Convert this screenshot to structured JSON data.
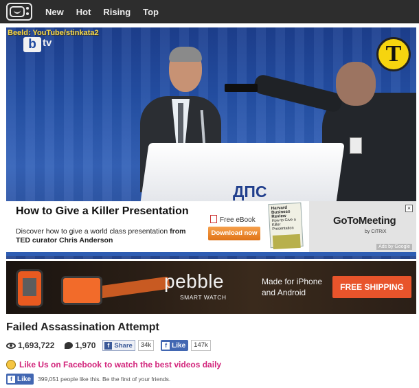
{
  "nav": {
    "items": [
      "New",
      "Hot",
      "Rising",
      "Top"
    ]
  },
  "video": {
    "credit": "Beeld: YouTube/stinkata2",
    "channel_b": "b",
    "channel_tv": "tv",
    "corner_logo": "T",
    "podium_text": "ДПС"
  },
  "ad": {
    "title": "How to Give a Killer Presentation",
    "desc_plain": "Discover how to give a world class presentation",
    "desc_strong": "from TED curator Chris Anderson",
    "ebook_label": "Free eBook",
    "download_label": "Download now",
    "book_title": "Harvard Business Review",
    "book_sub": "How to Give a Killer Presentation",
    "brand": "GoToMeeting",
    "brand_sub": "by CiTRiX",
    "ads_by": "Ads by Google",
    "close": "×"
  },
  "pebble": {
    "brand": "pebble",
    "sub": "SMART WATCH",
    "message": "Made for iPhone and Android",
    "button": "FREE SHIPPING"
  },
  "post": {
    "title": "Failed Assassination Attempt",
    "views": "1,693,722",
    "comments": "1,970",
    "share_label": "Share",
    "share_count": "34k",
    "like_label": "Like",
    "like_count": "147k"
  },
  "facebook": {
    "promo_link": "Like Us on Facebook",
    "promo_rest": "to watch the best videos daily",
    "like_label": "Like",
    "social_text": "399,051 people like this. Be the first of your friends."
  },
  "colors": {
    "topbar": "#2d2d2d",
    "accent_pink": "#d2247b",
    "facebook_blue": "#4267b2",
    "pebble_orange": "#e8542b"
  }
}
